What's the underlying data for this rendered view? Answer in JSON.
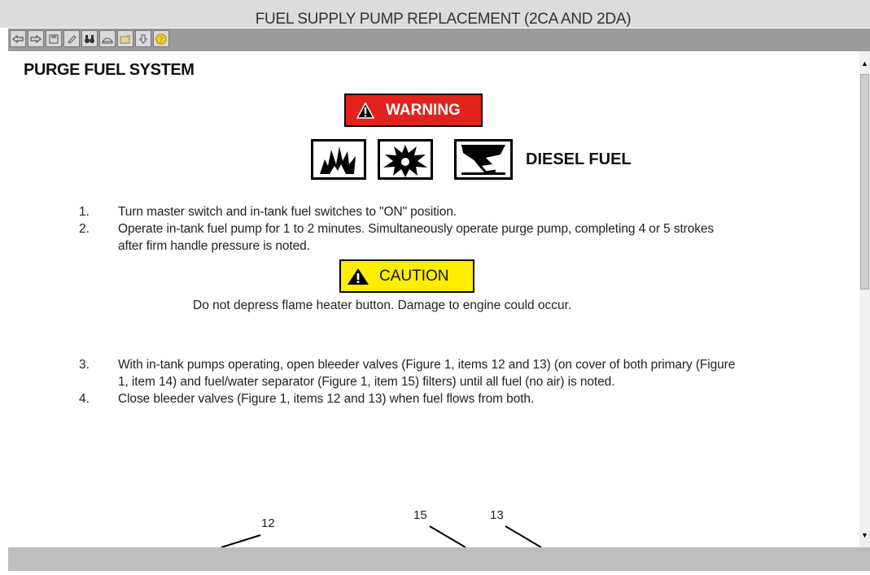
{
  "window": {
    "title": "FUEL SUPPLY PUMP REPLACEMENT (2CA AND 2DA)"
  },
  "toolbar": {
    "buttons": [
      {
        "name": "back-button",
        "icon": "arrow-left-icon"
      },
      {
        "name": "forward-button",
        "icon": "arrow-right-icon"
      },
      {
        "name": "save-button",
        "icon": "floppy-icon"
      },
      {
        "name": "edit-button",
        "icon": "pencil-icon"
      },
      {
        "name": "find-button",
        "icon": "binoculars-icon"
      },
      {
        "name": "print-button",
        "icon": "printer-icon"
      },
      {
        "name": "open-button",
        "icon": "folder-icon"
      },
      {
        "name": "download-button",
        "icon": "download-icon"
      },
      {
        "name": "help-button",
        "icon": "help-icon"
      }
    ]
  },
  "content": {
    "heading": "PURGE FUEL SYSTEM",
    "warning_label": "WARNING",
    "hazard_label": "DIESEL FUEL",
    "hazard_icons": [
      "fire-hazard-icon",
      "explosion-hazard-icon",
      "toxic-hazard-icon"
    ],
    "steps_a": [
      {
        "num": "1.",
        "lines": [
          "Turn master switch and in-tank fuel switches to \"ON\" position."
        ]
      },
      {
        "num": "2.",
        "lines": [
          "Operate in-tank fuel pump for 1 to 2 minutes.  Simultaneously operate purge pump, completing 4 or 5 strokes",
          "after firm handle pressure is noted."
        ]
      }
    ],
    "caution_label": "CAUTION",
    "caution_text": "Do not depress flame heater button.  Damage to engine could occur.",
    "steps_b": [
      {
        "num": "3.",
        "lines": [
          "With in-tank pumps operating, open bleeder valves (Figure 1, items 12 and 13) (on cover of both primary (Figure",
          "1, item 14) and fuel/water separator (Figure 1, item 15) filters) until all fuel (no air) is noted."
        ]
      },
      {
        "num": "4.",
        "lines": [
          "Close bleeder valves (Figure 1, items 12 and 13) when fuel flows from both."
        ]
      }
    ],
    "figure_labels": [
      "12",
      "15",
      "13"
    ]
  },
  "colors": {
    "warning_bg": "#e3221c",
    "caution_bg": "#ffee00",
    "toolbar_bg": "#9c9c9c",
    "statusbar_bg": "#bdbdbd"
  }
}
